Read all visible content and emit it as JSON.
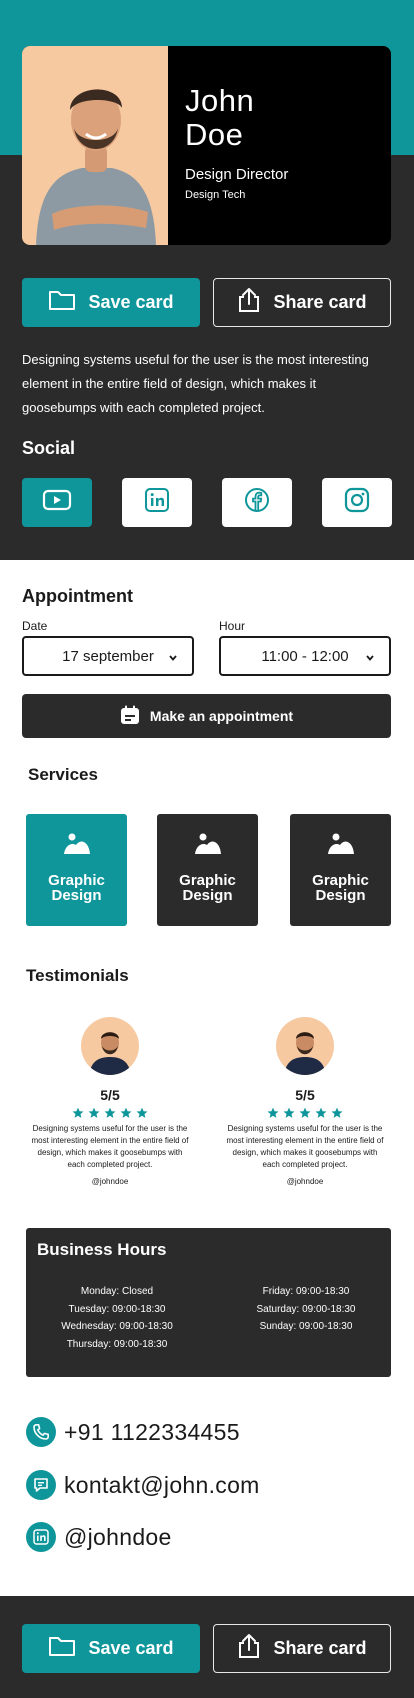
{
  "colors": {
    "accent": "#0f969a",
    "dark": "#2b2b2b",
    "photo_bg": "#f6c9a1"
  },
  "profile": {
    "first_name": "John",
    "last_name": "Doe",
    "title": "Design Director",
    "company": "Design Tech"
  },
  "actions": {
    "save_label": "Save card",
    "share_label": "Share card"
  },
  "bio": "Designing systems useful for the user is the most interesting element in the entire field of design, which makes it goosebumps with each completed project.",
  "social": {
    "title": "Social",
    "items": [
      {
        "icon": "youtube-icon",
        "active": true
      },
      {
        "icon": "linkedin-icon",
        "active": false
      },
      {
        "icon": "facebook-icon",
        "active": false
      },
      {
        "icon": "instagram-icon",
        "active": false
      }
    ]
  },
  "appointment": {
    "title": "Appointment",
    "date_label": "Date",
    "date_value": "17 september",
    "hour_label": "Hour",
    "hour_value": "11:00 - 12:00",
    "button_label": "Make an appointment"
  },
  "services": {
    "title": "Services",
    "items": [
      {
        "label": "Graphic Design",
        "active": true
      },
      {
        "label": "Graphic Design",
        "active": false
      },
      {
        "label": "Graphic Design",
        "active": false
      }
    ]
  },
  "testimonials": {
    "title": "Testimonials",
    "items": [
      {
        "rating": "5/5",
        "stars": 5,
        "text": "Designing systems useful for the user is the most interesting element in the entire field of design, which makes it goosebumps with each completed project.",
        "handle": "@johndoe"
      },
      {
        "rating": "5/5",
        "stars": 5,
        "text": "Designing systems useful for the user is the most interesting element in the entire field of design, which makes it goosebumps with each completed project.",
        "handle": "@johndoe"
      }
    ]
  },
  "business_hours": {
    "title": "Business Hours",
    "left": [
      "Monday: Closed",
      "Tuesday: 09:00-18:30",
      "Wednesday: 09:00-18:30",
      "Thursday: 09:00-18:30"
    ],
    "right": [
      "Friday: 09:00-18:30",
      "Saturday: 09:00-18:30",
      "Sunday: 09:00-18:30"
    ]
  },
  "contact": {
    "phone_prefix": "+91 ",
    "phone_number": "1122334455",
    "email": "kontakt@john.com",
    "linkedin": "@johndoe"
  }
}
